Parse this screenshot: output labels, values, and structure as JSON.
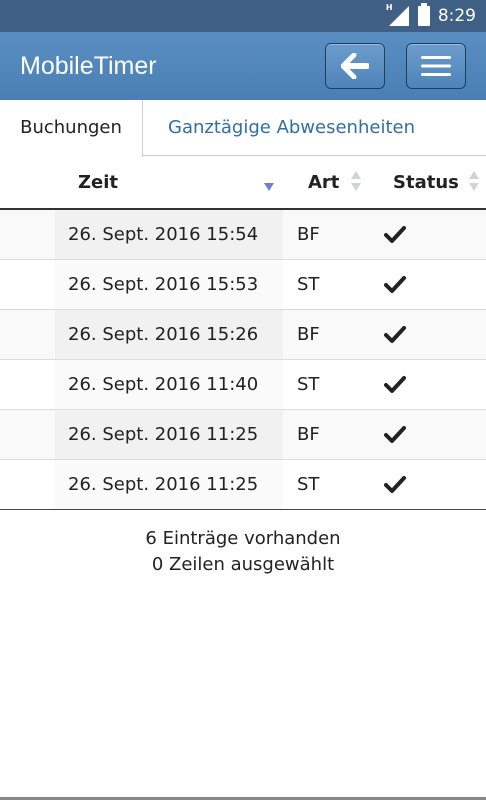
{
  "status_bar": {
    "time": "8:29",
    "network": "H",
    "icons": [
      "signal-icon",
      "battery-icon"
    ]
  },
  "header": {
    "title": "MobileTimer",
    "back_icon": "arrow-left-icon",
    "menu_icon": "hamburger-menu-icon"
  },
  "tabs": [
    {
      "label": "Buchungen",
      "active": true
    },
    {
      "label": "Ganztägige Abwesenheiten",
      "active": false
    }
  ],
  "table": {
    "columns": [
      {
        "label": "Zeit",
        "sort": "desc"
      },
      {
        "label": "Art",
        "sort": "none"
      },
      {
        "label": "Status",
        "sort": "none"
      }
    ],
    "rows": [
      {
        "zeit": "26. Sept. 2016 15:54",
        "art": "BF",
        "status": "check-icon"
      },
      {
        "zeit": "26. Sept. 2016 15:53",
        "art": "ST",
        "status": "check-icon"
      },
      {
        "zeit": "26. Sept. 2016 15:26",
        "art": "BF",
        "status": "check-icon"
      },
      {
        "zeit": "26. Sept. 2016 11:40",
        "art": "ST",
        "status": "check-icon"
      },
      {
        "zeit": "26. Sept. 2016 11:25",
        "art": "BF",
        "status": "check-icon"
      },
      {
        "zeit": "26. Sept. 2016 11:25",
        "art": "ST",
        "status": "check-icon"
      }
    ]
  },
  "info": {
    "entries": "6 Einträge vorhanden",
    "selected": "0 Zeilen ausgewählt"
  },
  "colors": {
    "header": "#4a7fb4",
    "status_bar": "#3f5f84",
    "tab_link": "#2f6fa6",
    "sort_active": "#6f7fd6"
  }
}
